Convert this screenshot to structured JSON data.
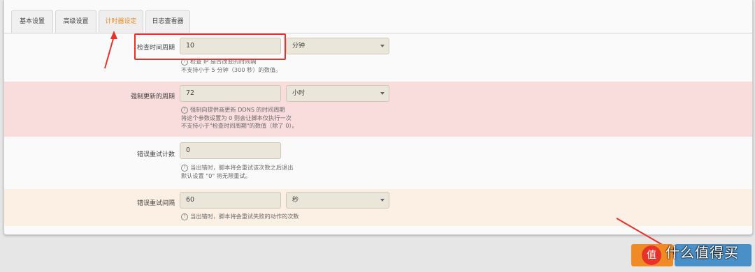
{
  "tabs": [
    {
      "label": "基本设置"
    },
    {
      "label": "高级设置"
    },
    {
      "label": "计时器设定"
    },
    {
      "label": "日志查看器"
    }
  ],
  "rows": {
    "check_interval": {
      "label": "检查时间周期",
      "value": "10",
      "unit": "分钟",
      "help": [
        "检查 IP 是否改变的时间隔",
        "不支持小于 5 分钟（300 秒）的数值。"
      ]
    },
    "force_update": {
      "label": "强制更新的周期",
      "value": "72",
      "unit": "小时",
      "help": [
        "强制向提供商更新 DDNS 的时间周期",
        "将这个参数设置为 0 则会让脚本仅执行一次",
        "不支持小于\"检查时间周期\"的数值（除了 0）。"
      ]
    },
    "retry_count": {
      "label": "错误重试计数",
      "value": "0",
      "help": [
        "当出错时，脚本将会重试该次数之后退出",
        "默认设置 \"0\" 将无限重试。"
      ]
    },
    "retry_interval": {
      "label": "错误重试间隔",
      "value": "60",
      "unit": "秒",
      "help": [
        "当出错时，脚本将会重试失败的动作的次数"
      ]
    }
  },
  "help_icon": "question-circle-icon",
  "watermark": {
    "text": "什么值得买",
    "logo": "值"
  },
  "colors": {
    "active_tab": "#f08a24",
    "row_pink": "#f9dcdc",
    "row_peach": "#fcefe3",
    "annotation_red": "#e8312b"
  }
}
